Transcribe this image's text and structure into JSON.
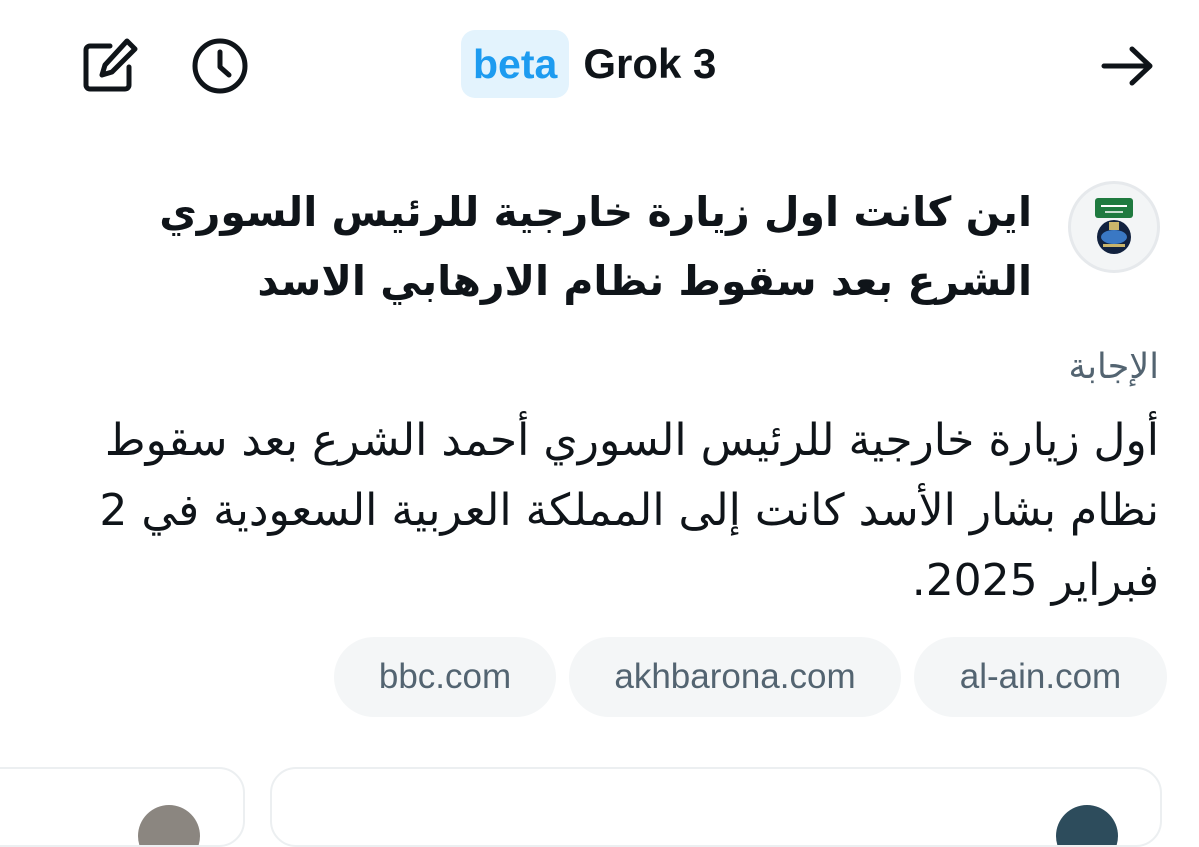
{
  "header": {
    "badge": "beta",
    "title": "Grok 3",
    "icons": {
      "compose": "compose-icon",
      "history": "history-clock-icon",
      "forward": "arrow-right-icon"
    }
  },
  "conversation": {
    "user_question": "اين كانت اول زيارة خارجية للرئيس السوري الشرع بعد سقوط نظام الارهابي الاسد",
    "answer_label": "الإجابة",
    "answer_text": "أول زيارة خارجية للرئيس السوري أحمد الشرع بعد سقوط نظام بشار الأسد كانت إلى المملكة العربية السعودية في 2 فبراير 2025."
  },
  "sources": [
    {
      "label": "al-ain.com"
    },
    {
      "label": "akhbarona.com"
    },
    {
      "label": "bbc.com"
    }
  ],
  "colors": {
    "text_primary": "#0f1419",
    "text_secondary": "#536471",
    "accent": "#1d9bf0",
    "badge_bg": "#e3f3fd",
    "chip_bg": "#f4f6f7"
  }
}
